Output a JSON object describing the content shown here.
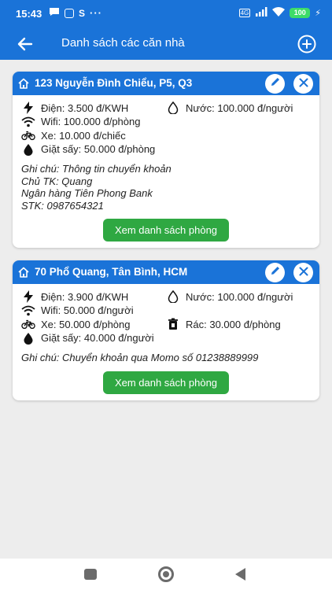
{
  "status": {
    "time": "15:43",
    "battery": "100"
  },
  "appbar": {
    "title": "Danh sách các căn nhà"
  },
  "houses": [
    {
      "address": "123 Nguyễn Đình Chiểu, P5, Q3",
      "electric": "Điện: 3.500 đ/KWH",
      "water": "Nước: 100.000 đ/người",
      "wifi": "Wifi: 100.000 đ/phòng",
      "vehicle": "Xe: 10.000 đ/chiếc",
      "laundry": "Giặt sấy: 50.000 đ/phòng",
      "note_lines": [
        "Ghi chú: Thông tin chuyển khoản",
        "Chủ TK: Quang",
        "Ngân hàng Tiên Phong Bank",
        "STK: 0987654321"
      ],
      "rooms_button": "Xem danh sách phòng"
    },
    {
      "address": "70 Phổ Quang, Tân Bình, HCM",
      "electric": "Điện: 3.900 đ/KWH",
      "water": "Nước: 100.000 đ/người",
      "wifi": "Wifi: 50.000 đ/người",
      "vehicle": "Xe: 50.000 đ/phòng",
      "trash": "Rác: 30.000 đ/phòng",
      "laundry": "Giặt sấy: 40.000 đ/người",
      "note_lines": [
        "Ghi chú: Chuyển khoản qua Momo số 01238889999"
      ],
      "rooms_button": "Xem danh sách phòng"
    }
  ],
  "colors": {
    "primary": "#1a73d8",
    "button_green": "#2fa842",
    "background": "#ededed"
  }
}
